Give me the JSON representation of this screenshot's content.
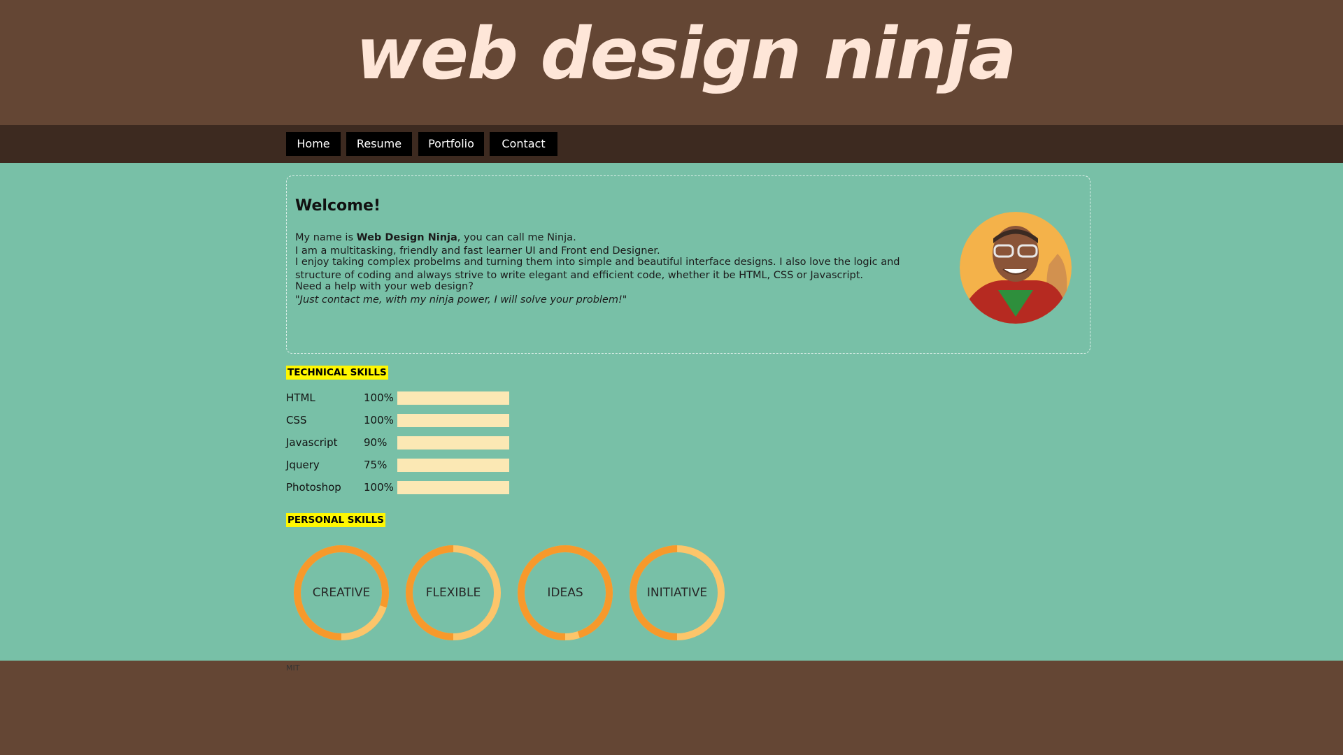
{
  "site": {
    "logo_text": "web design ninja"
  },
  "nav": {
    "items": [
      {
        "label": "Home"
      },
      {
        "label": "Resume"
      },
      {
        "label": "Portfolio"
      },
      {
        "label": "Contact"
      }
    ]
  },
  "welcome": {
    "title": "Welcome!",
    "intro_prefix": "My name is ",
    "intro_name": "Web Design Ninja",
    "intro_suffix": ", you can call me Ninja.",
    "intro_line2": "I am a multitasking, friendly and fast learner UI and Front end Designer.",
    "paragraph2": "I enjoy taking complex probelms and turning them into simple and beautiful interface designs. I also love the logic and structure of coding and always strive to write elegant and efficient code, whether it be HTML, CSS or Javascript.",
    "question": "Need a help with your web design?",
    "quote": "\"Just contact me, with my ninja power, I will solve your problem!\""
  },
  "technical_skills": {
    "heading": "TECHNICAL SKILLS",
    "items": [
      {
        "name": "HTML",
        "percent": "100%"
      },
      {
        "name": "CSS",
        "percent": "100%"
      },
      {
        "name": "Javascript",
        "percent": "90%"
      },
      {
        "name": "Jquery",
        "percent": "75%"
      },
      {
        "name": "Photoshop",
        "percent": "100%"
      }
    ]
  },
  "personal_skills": {
    "heading": "PERSONAL SKILLS",
    "items": [
      {
        "label": "CREATIVE",
        "level": 0.8
      },
      {
        "label": "FLEXIBLE",
        "level": 0.5
      },
      {
        "label": "IDEAS",
        "level": 0.95
      },
      {
        "label": "INITIATIVE",
        "level": 0.5
      }
    ]
  },
  "footer": {
    "text": "MIT"
  },
  "colors": {
    "header_bg": "#644634",
    "nav_bg": "#3d2a20",
    "main_bg": "#78c0a7",
    "logo_text": "#fee6d8",
    "badge_yellow": "#fff700",
    "bar_fill": "#fbe8b4",
    "ring_dark": "#f7992b",
    "ring_light": "#fcc56a"
  }
}
